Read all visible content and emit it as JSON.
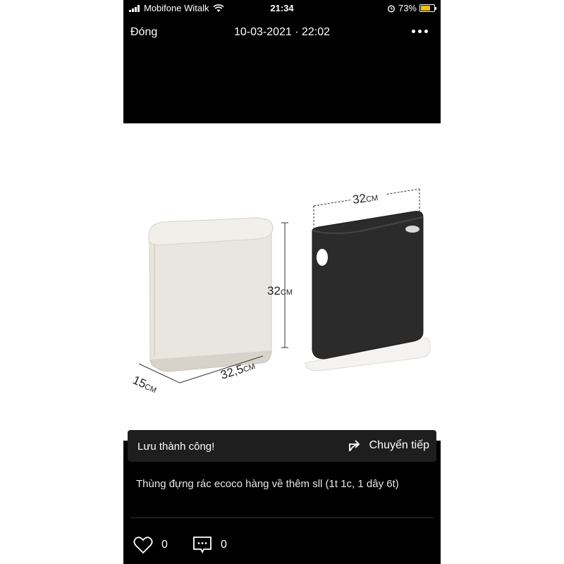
{
  "status_bar": {
    "carrier": "Mobifone Witalk",
    "time": "21:34",
    "battery_percent": "73%",
    "battery_level": 0.73,
    "icons": [
      "signal-icon",
      "wifi-icon",
      "alarm-icon",
      "battery-icon"
    ]
  },
  "nav": {
    "close_label": "Đóng",
    "title": "10-03-2021 · 22:02",
    "more_icon": "more-dots-icon"
  },
  "photo": {
    "left_width": "32,5",
    "left_width_unit": "CM",
    "left_depth": "15",
    "left_depth_unit": "CM",
    "left_height": "32",
    "left_height_unit": "CM",
    "right_width": "32",
    "right_width_unit": "CM"
  },
  "toast": {
    "message": "Lưu thành công!",
    "forward_label": "Chuyển tiếp",
    "forward_icon": "share-arrow-icon"
  },
  "caption": "Thùng đựng rác ecoco hàng về thêm sll (1t 1c, 1 dây 6t)",
  "actions": {
    "like_count": "0",
    "comment_count": "0"
  },
  "colors": {
    "background": "#000000",
    "battery": "#f2c200",
    "bin_white": "#e9e6e0",
    "bin_black": "#2b2b2b"
  }
}
